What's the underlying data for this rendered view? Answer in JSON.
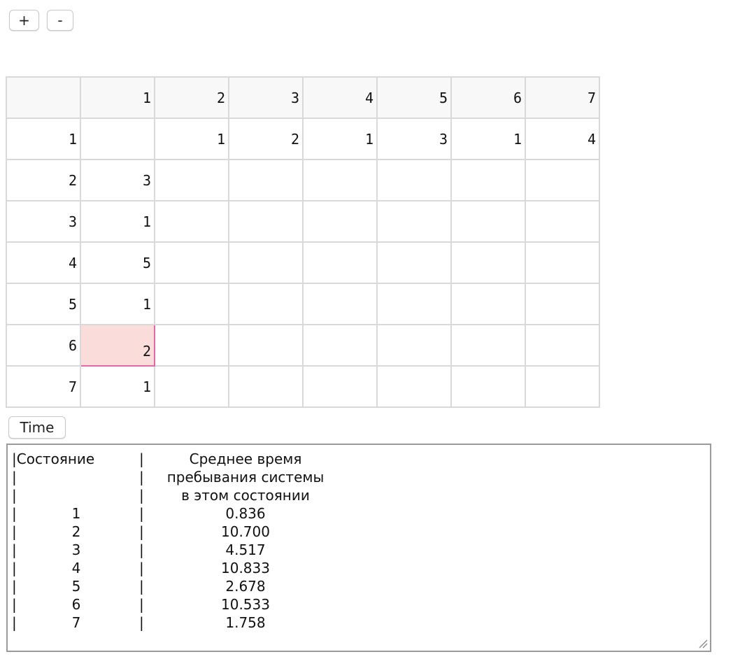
{
  "toolbar": {
    "plus_label": "+",
    "minus_label": "-"
  },
  "matrix": {
    "header": [
      "",
      "1",
      "2",
      "3",
      "4",
      "5",
      "6",
      "7"
    ],
    "rows": [
      [
        "1",
        "",
        "1",
        "2",
        "1",
        "3",
        "1",
        "4"
      ],
      [
        "2",
        "3",
        "",
        "",
        "",
        "",
        "",
        ""
      ],
      [
        "3",
        "1",
        "",
        "",
        "",
        "",
        "",
        ""
      ],
      [
        "4",
        "5",
        "",
        "",
        "",
        "",
        "",
        ""
      ],
      [
        "5",
        "1",
        "",
        "",
        "",
        "",
        "",
        ""
      ],
      [
        "6",
        "2",
        "",
        "",
        "",
        "",
        "",
        ""
      ],
      [
        "7",
        "1",
        "",
        "",
        "",
        "",
        "",
        ""
      ]
    ],
    "selected_cell": {
      "row": 6,
      "col": 1
    }
  },
  "time_button": {
    "label": "Time"
  },
  "output": {
    "header_col1": "|Состояние",
    "header_lines": [
      "Среднее время",
      "пребывания системы",
      "в этом состоянии"
    ],
    "rows": [
      {
        "state": "1",
        "value": "0.836"
      },
      {
        "state": "2",
        "value": "10.700"
      },
      {
        "state": "3",
        "value": "4.517"
      },
      {
        "state": "4",
        "value": "10.833"
      },
      {
        "state": "5",
        "value": "2.678"
      },
      {
        "state": "6",
        "value": "10.533"
      },
      {
        "state": "7",
        "value": "1.758"
      }
    ],
    "separator": "|"
  },
  "colors": {
    "selected_fill": "#fadcda",
    "selected_border": "#e46aa6",
    "grid": "#d9d9d9"
  }
}
